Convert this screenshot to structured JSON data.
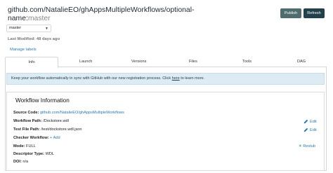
{
  "header": {
    "title": "github.com/NatalieEO/ghAppsMultipleWorkflows/optional-",
    "title_line2_prefix": "name:",
    "title_line2_version": "master",
    "publish_label": "Publish",
    "refresh_label": "Refresh"
  },
  "version_select": {
    "value": "master"
  },
  "last_modified": {
    "label": "Last Modified:",
    "value": "48 days ago"
  },
  "manage_labels": "Manage labels",
  "tabs": [
    {
      "label": "Info",
      "active": true
    },
    {
      "label": "Launch"
    },
    {
      "label": "Versions"
    },
    {
      "label": "Files"
    },
    {
      "label": "Tools"
    },
    {
      "label": "DAG"
    }
  ],
  "banner": {
    "text_before": "Keep your workflow automatically in sync with GitHub with our new registration process. Click ",
    "link": "here",
    "text_after": " to learn more."
  },
  "workflow_info": {
    "title": "Workflow Information",
    "source_code_label": "Source Code:",
    "source_code_value": "github.com/NatalieEO/ghAppsMultipleWorkflows",
    "workflow_path_label": "Workflow Path:",
    "workflow_path_value": "/Dockstore.wdl",
    "test_file_path_label": "Test File Path:",
    "test_file_path_value": "/test/dockstore.wdl.json",
    "checker_label": "Checker Workflow:",
    "checker_add": "Add",
    "mode_label": "Mode:",
    "mode_value": "FULL",
    "descriptor_label": "Descriptor Type:",
    "descriptor_value": "WDL",
    "doi_label": "DOI:",
    "doi_value": "n/a",
    "edit_label": "Edit",
    "restub_label": "Restub"
  },
  "colors": {
    "link": "#2d78ae",
    "publish_bg": "#4f6c6e",
    "refresh_bg": "#24414b",
    "banner_bg": "#dcebf4"
  }
}
